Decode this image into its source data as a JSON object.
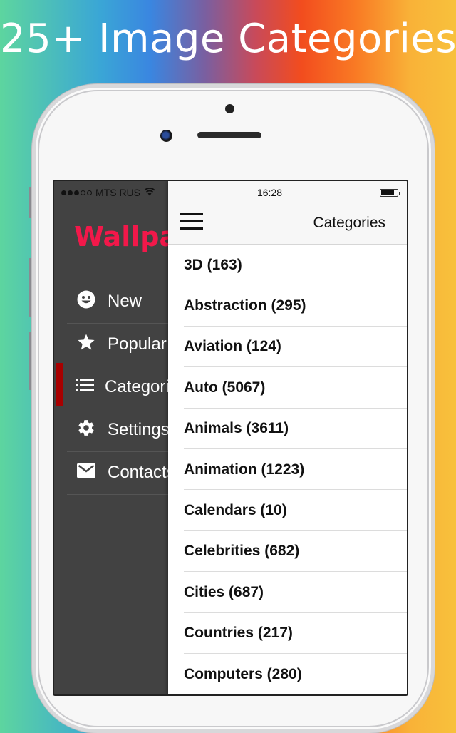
{
  "headline": "25+ Image Categories",
  "status_bar": {
    "signal_bars_filled": 3,
    "signal_bars_total": 5,
    "carrier": "MTS RUS",
    "time": "16:28",
    "battery_level": 0.8
  },
  "side_menu": {
    "logo": "Wallpapers",
    "active_item": "Categories",
    "accent_color": "#a80000",
    "logo_color": "#f2184a",
    "items": [
      {
        "label": "New",
        "icon": "smiley-face-icon",
        "glyph": "☻"
      },
      {
        "label": "Popular",
        "icon": "star-icon",
        "glyph": "★"
      },
      {
        "label": "Categories",
        "icon": "list-icon",
        "glyph": "☰"
      },
      {
        "label": "Settings",
        "icon": "gear-icon",
        "glyph": "⚙"
      },
      {
        "label": "Contacts",
        "icon": "envelope-icon",
        "glyph": "✉"
      }
    ]
  },
  "navbar": {
    "title": "Categories",
    "menu_icon": "hamburger-icon"
  },
  "categories": [
    {
      "label": "3D (163)"
    },
    {
      "label": "Abstraction (295)"
    },
    {
      "label": "Aviation (124)"
    },
    {
      "label": "Auto (5067)"
    },
    {
      "label": "Animals (3611)"
    },
    {
      "label": "Animation (1223)"
    },
    {
      "label": "Calendars (10)"
    },
    {
      "label": "Celebrities (682)"
    },
    {
      "label": "Cities (687)"
    },
    {
      "label": "Countries (217)"
    },
    {
      "label": "Computers (280)"
    }
  ]
}
